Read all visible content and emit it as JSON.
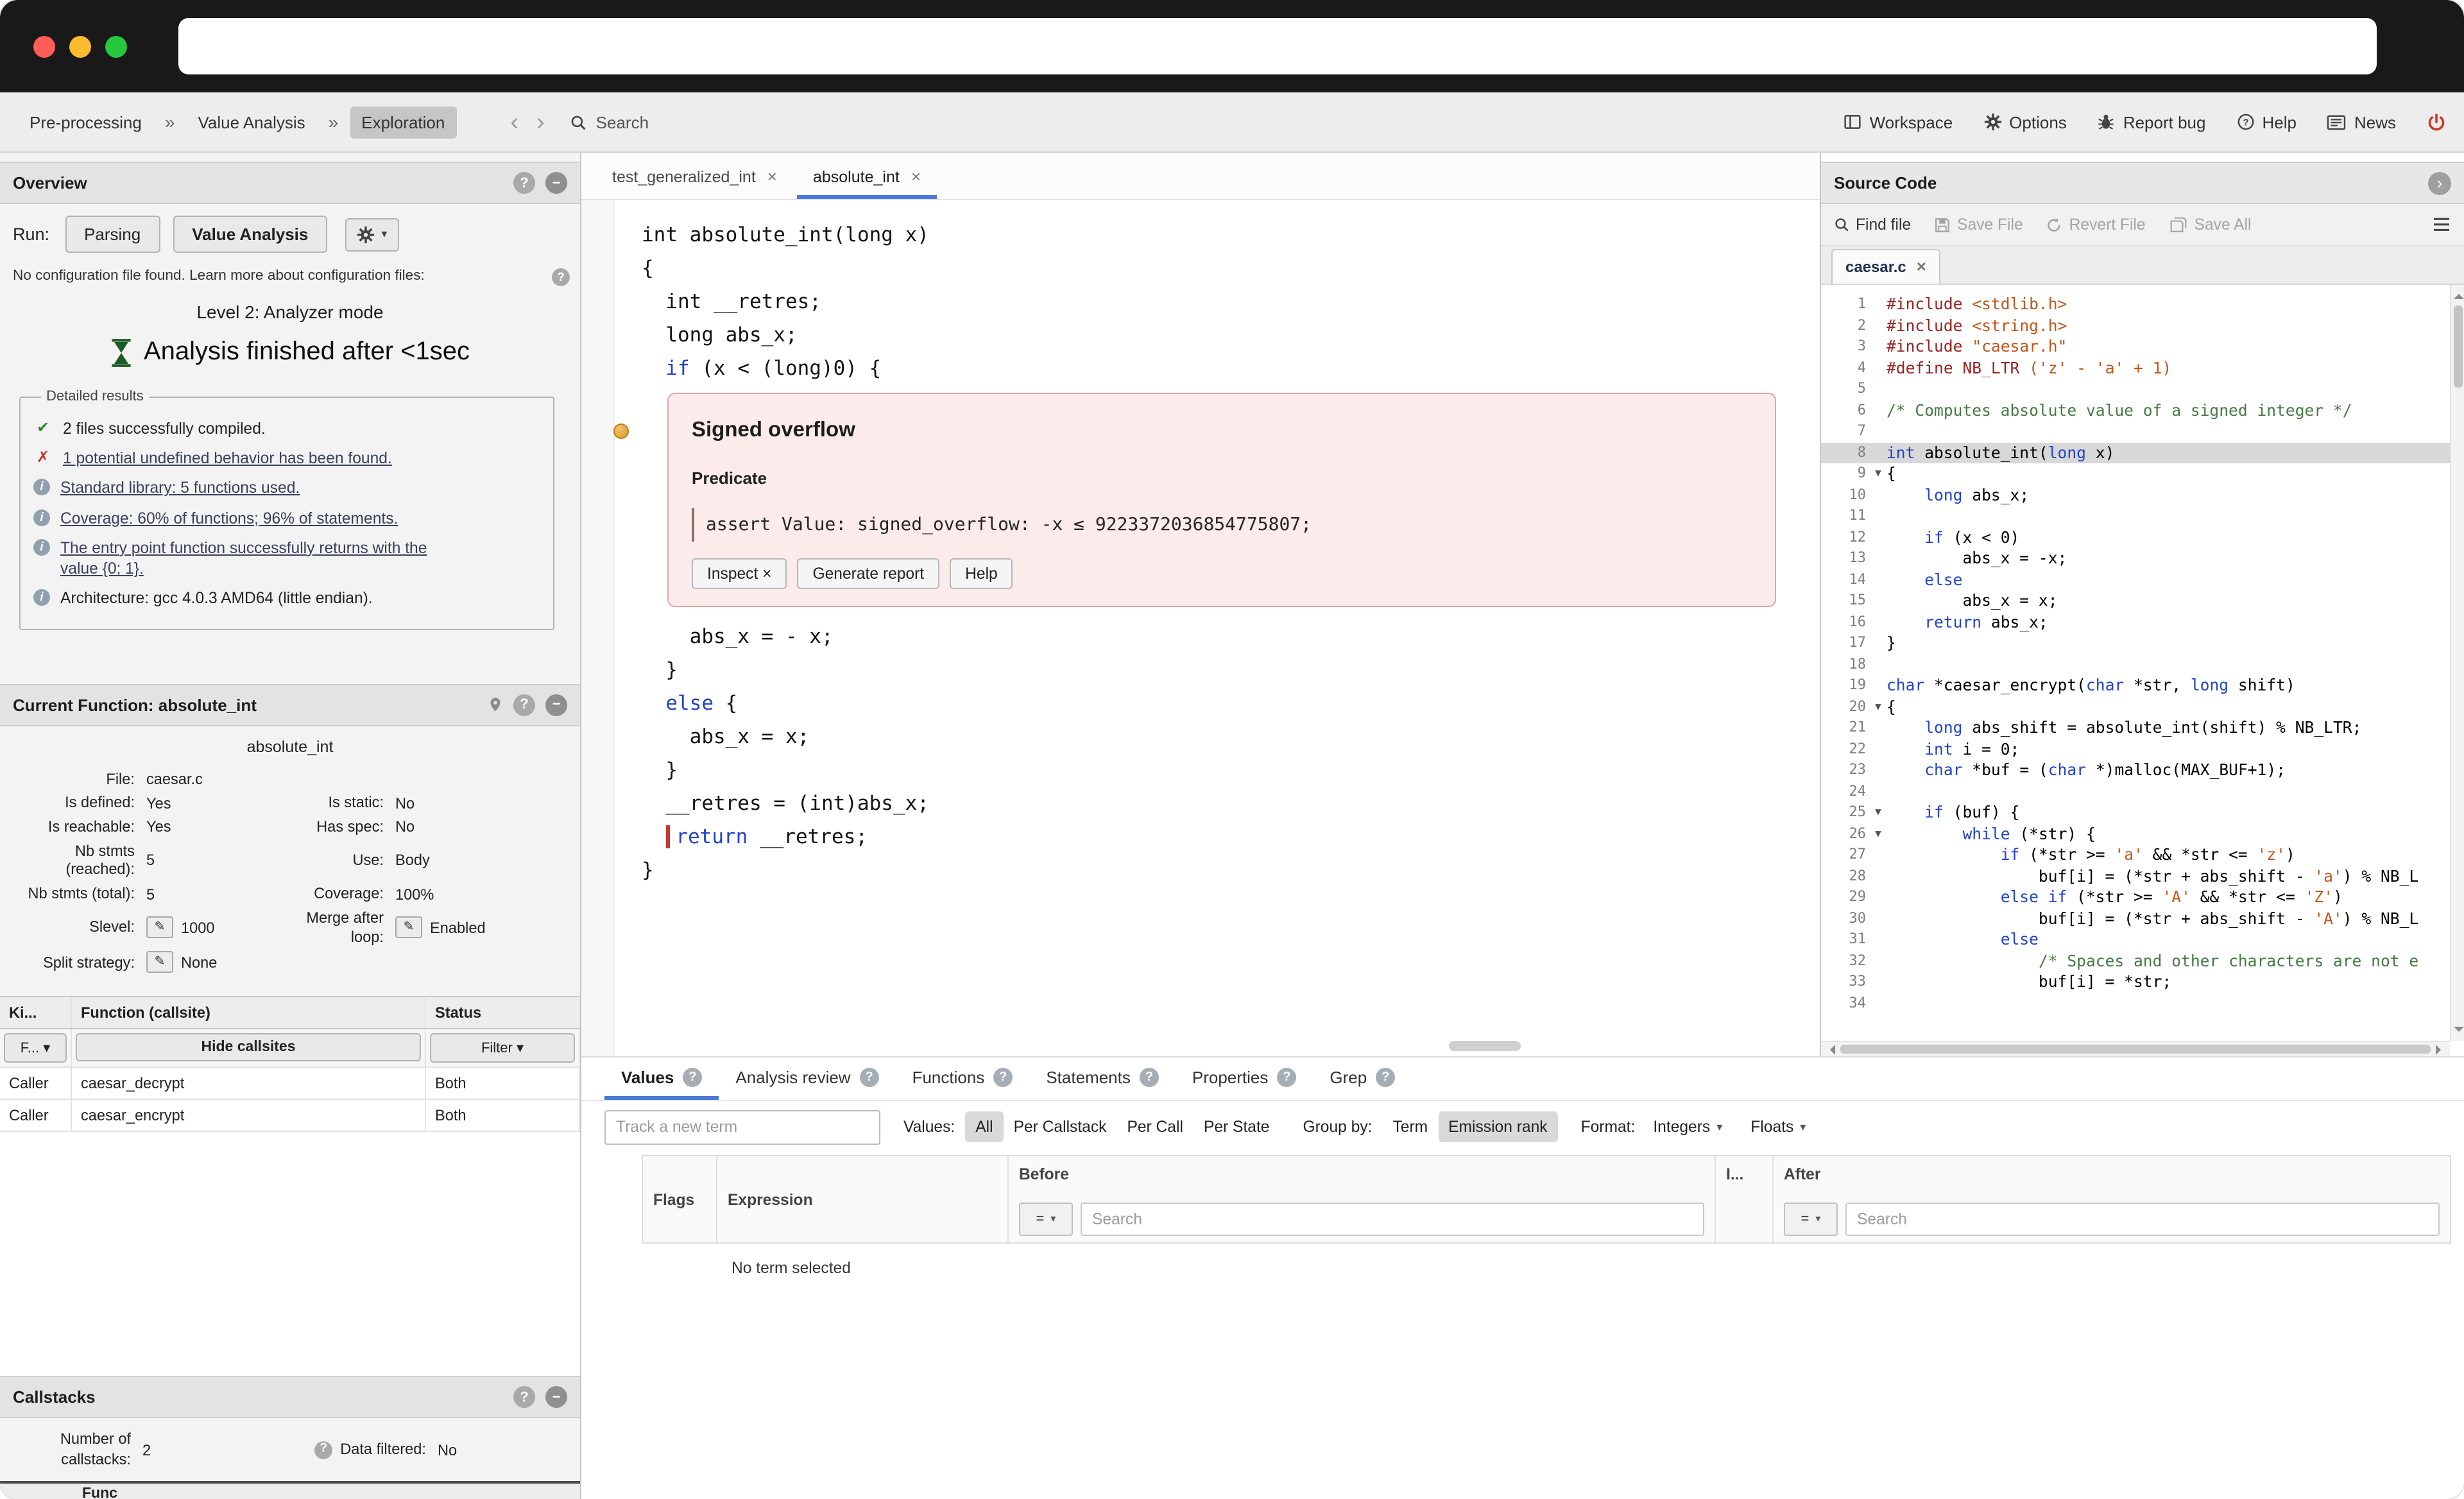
{
  "colors": {
    "accent": "#4a79d9",
    "alert_bg": "#fcebeb",
    "alert_border": "#e0a4a4",
    "marker_amber": "#dd9a26",
    "power_red": "#cf3428"
  },
  "toolbar": {
    "breadcrumb": [
      {
        "label": "Pre-processing",
        "active": false
      },
      {
        "label": "Value Analysis",
        "active": false
      },
      {
        "label": "Exploration",
        "active": true
      }
    ],
    "nav_back": "‹",
    "nav_forward": "›",
    "search_label": "Search",
    "actions": [
      {
        "label": "Workspace",
        "icon": "workspace"
      },
      {
        "label": "Options",
        "icon": "options"
      },
      {
        "label": "Report bug",
        "icon": "report-bug"
      },
      {
        "label": "Help",
        "icon": "help"
      },
      {
        "label": "News",
        "icon": "news"
      }
    ]
  },
  "sidebar": {
    "overview": {
      "title": "Overview",
      "run_label": "Run:",
      "buttons": [
        "Parsing",
        "Value Analysis"
      ],
      "config_note": "No configuration file found. Learn more about configuration files:",
      "level": "Level 2: Analyzer mode",
      "finished": "Analysis finished after <1sec",
      "results_legend": "Detailed results",
      "results": [
        {
          "icon": "check",
          "text": "2 files successfully compiled.",
          "link": false
        },
        {
          "icon": "cross",
          "text": "1 potential undefined behavior has been found.",
          "link": true
        },
        {
          "icon": "info",
          "text": "Standard library: 5 functions used.",
          "link": true
        },
        {
          "icon": "info",
          "text": "Coverage: 60% of functions; 96% of statements.",
          "link": true
        },
        {
          "icon": "info",
          "text": "The entry point function successfully returns with the value {0; 1}.",
          "link": true
        },
        {
          "icon": "info",
          "text": "Architecture: gcc 4.0.3 AMD64 (little endian).",
          "link": false
        }
      ]
    },
    "current_function": {
      "title": "Current Function: absolute_int",
      "name": "absolute_int",
      "rows": [
        [
          {
            "l": "File:",
            "v": "caesar.c"
          }
        ],
        [
          {
            "l": "Is defined:",
            "v": "Yes"
          },
          {
            "l": "Is static:",
            "v": "No"
          }
        ],
        [
          {
            "l": "Is reachable:",
            "v": "Yes"
          },
          {
            "l": "Has spec:",
            "v": "No"
          }
        ],
        [
          {
            "l": "Nb stmts (reached):",
            "v": "5"
          },
          {
            "l": "Use:",
            "v": "Body"
          }
        ],
        [
          {
            "l": "Nb stmts (total):",
            "v": "5"
          },
          {
            "l": "Coverage:",
            "v": "100%"
          }
        ],
        [
          {
            "l": "Slevel:",
            "v": "1000",
            "edit": true
          },
          {
            "l": "Merge after loop:",
            "v": "Enabled",
            "edit": true
          }
        ],
        [
          {
            "l": "Split strategy:",
            "v": "None",
            "edit": true
          }
        ]
      ]
    },
    "callers": {
      "headers": [
        "Ki...",
        "Function (callsite)",
        "Status"
      ],
      "filter_kind": "F...",
      "filter_hide": "Hide callsites",
      "filter_status": "Filter",
      "rows": [
        [
          "Caller",
          "caesar_decrypt",
          "Both"
        ],
        [
          "Caller",
          "caesar_encrypt",
          "Both"
        ]
      ]
    },
    "callstacks": {
      "title": "Callstacks",
      "count_label": "Number of callstacks:",
      "count_value": "2",
      "filtered_label": "Data filtered:",
      "filtered_value": "No",
      "cut_label": "Func"
    }
  },
  "ast": {
    "tabs": [
      {
        "label": "test_generalized_int",
        "active": false
      },
      {
        "label": "absolute_int",
        "active": true
      }
    ],
    "lines": [
      {
        "toks": [
          [
            "p",
            "int absolute_int(long x)"
          ]
        ]
      },
      {
        "toks": [
          [
            "p",
            "{"
          ]
        ]
      },
      {
        "toks": [
          [
            "p",
            "  int __retres;"
          ]
        ]
      },
      {
        "toks": [
          [
            "p",
            "  long abs_x;"
          ]
        ]
      },
      {
        "toks": [
          [
            "p",
            "  "
          ],
          [
            "k",
            "if"
          ],
          [
            "p",
            " (x < (long)0) {"
          ]
        ]
      },
      {
        "alert": true
      },
      {
        "toks": [
          [
            "p",
            "    abs_x = - x;"
          ]
        ]
      },
      {
        "toks": [
          [
            "p",
            "  }"
          ]
        ]
      },
      {
        "toks": [
          [
            "p",
            "  "
          ],
          [
            "k",
            "else"
          ],
          [
            "p",
            " {"
          ]
        ]
      },
      {
        "toks": [
          [
            "p",
            "    abs_x = x;"
          ]
        ]
      },
      {
        "toks": [
          [
            "p",
            "  }"
          ]
        ]
      },
      {
        "toks": [
          [
            "p",
            "  __retres = (int)abs_x;"
          ]
        ]
      },
      {
        "ind": "  ",
        "bar": true,
        "toks": [
          [
            "k",
            "return"
          ],
          [
            "p",
            " __retres;"
          ]
        ]
      },
      {
        "toks": [
          [
            "p",
            "}"
          ]
        ]
      }
    ],
    "alert": {
      "title": "Signed overflow",
      "subtitle": "Predicate",
      "assert_text": "assert Value: signed_overflow: -x ≤ 9223372036854775807;",
      "buttons": [
        "Inspect ×",
        "Generate report",
        "Help"
      ]
    }
  },
  "source": {
    "title": "Source Code",
    "toolbar": [
      {
        "label": "Find file",
        "icon": "find",
        "enabled": true
      },
      {
        "label": "Save File",
        "icon": "save",
        "enabled": false
      },
      {
        "label": "Revert File",
        "icon": "revert",
        "enabled": false
      },
      {
        "label": "Save All",
        "icon": "save-all",
        "enabled": false
      }
    ],
    "tab": "caesar.c",
    "lines": [
      {
        "n": 1,
        "toks": [
          [
            "d",
            "#include "
          ],
          [
            "s",
            "<stdlib.h>"
          ]
        ]
      },
      {
        "n": 2,
        "toks": [
          [
            "d",
            "#include "
          ],
          [
            "s",
            "<string.h>"
          ]
        ]
      },
      {
        "n": 3,
        "toks": [
          [
            "d",
            "#include "
          ],
          [
            "s",
            "\"caesar.h\""
          ]
        ]
      },
      {
        "n": 4,
        "toks": [
          [
            "d",
            "#define NB_LTR "
          ],
          [
            "s",
            "('z' - 'a' + 1)"
          ]
        ]
      },
      {
        "n": 5,
        "toks": []
      },
      {
        "n": 6,
        "toks": [
          [
            "c",
            "/* Computes absolute value of a signed integer */"
          ]
        ]
      },
      {
        "n": 7,
        "toks": []
      },
      {
        "n": 8,
        "hl": true,
        "toks": [
          [
            "k",
            "int"
          ],
          [
            "p",
            " absolute_int("
          ],
          [
            "k",
            "long"
          ],
          [
            "p",
            " x)"
          ]
        ]
      },
      {
        "n": 9,
        "fold": true,
        "toks": [
          [
            "p",
            "{"
          ]
        ]
      },
      {
        "n": 10,
        "toks": [
          [
            "p",
            "    "
          ],
          [
            "k",
            "long"
          ],
          [
            "p",
            " abs_x;"
          ]
        ]
      },
      {
        "n": 11,
        "toks": []
      },
      {
        "n": 12,
        "toks": [
          [
            "p",
            "    "
          ],
          [
            "k",
            "if"
          ],
          [
            "p",
            " (x < 0)"
          ]
        ]
      },
      {
        "n": 13,
        "toks": [
          [
            "p",
            "        abs_x = -x;"
          ]
        ]
      },
      {
        "n": 14,
        "toks": [
          [
            "p",
            "    "
          ],
          [
            "k",
            "else"
          ]
        ]
      },
      {
        "n": 15,
        "toks": [
          [
            "p",
            "        abs_x = x;"
          ]
        ]
      },
      {
        "n": 16,
        "toks": [
          [
            "p",
            "    "
          ],
          [
            "k",
            "return"
          ],
          [
            "p",
            " abs_x;"
          ]
        ]
      },
      {
        "n": 17,
        "toks": [
          [
            "p",
            "}"
          ]
        ]
      },
      {
        "n": 18,
        "toks": []
      },
      {
        "n": 19,
        "toks": [
          [
            "k",
            "char"
          ],
          [
            "p",
            " *caesar_encrypt("
          ],
          [
            "k",
            "char"
          ],
          [
            "p",
            " *str, "
          ],
          [
            "k",
            "long"
          ],
          [
            "p",
            " shift)"
          ]
        ]
      },
      {
        "n": 20,
        "fold": true,
        "toks": [
          [
            "p",
            "{"
          ]
        ]
      },
      {
        "n": 21,
        "toks": [
          [
            "p",
            "    "
          ],
          [
            "k",
            "long"
          ],
          [
            "p",
            " abs_shift = absolute_int(shift) % NB_LTR;"
          ]
        ]
      },
      {
        "n": 22,
        "toks": [
          [
            "p",
            "    "
          ],
          [
            "k",
            "int"
          ],
          [
            "p",
            " i = 0;"
          ]
        ]
      },
      {
        "n": 23,
        "toks": [
          [
            "p",
            "    "
          ],
          [
            "k",
            "char"
          ],
          [
            "p",
            " *buf = ("
          ],
          [
            "k",
            "char"
          ],
          [
            "p",
            " *)malloc(MAX_BUF+1);"
          ]
        ]
      },
      {
        "n": 24,
        "toks": []
      },
      {
        "n": 25,
        "fold": true,
        "toks": [
          [
            "p",
            "    "
          ],
          [
            "k",
            "if"
          ],
          [
            "p",
            " (buf) {"
          ]
        ]
      },
      {
        "n": 26,
        "fold": true,
        "toks": [
          [
            "p",
            "        "
          ],
          [
            "k",
            "while"
          ],
          [
            "p",
            " (*str) {"
          ]
        ]
      },
      {
        "n": 27,
        "toks": [
          [
            "p",
            "            "
          ],
          [
            "k",
            "if"
          ],
          [
            "p",
            " (*str >= "
          ],
          [
            "s",
            "'a'"
          ],
          [
            "p",
            " && *str <= "
          ],
          [
            "s",
            "'z'"
          ],
          [
            "p",
            ")"
          ]
        ]
      },
      {
        "n": 28,
        "toks": [
          [
            "p",
            "                buf[i] = (*str + abs_shift - "
          ],
          [
            "s",
            "'a'"
          ],
          [
            "p",
            ") % NB_L"
          ]
        ]
      },
      {
        "n": 29,
        "toks": [
          [
            "p",
            "            "
          ],
          [
            "k",
            "else"
          ],
          [
            "p",
            " "
          ],
          [
            "k",
            "if"
          ],
          [
            "p",
            " (*str >= "
          ],
          [
            "s",
            "'A'"
          ],
          [
            "p",
            " && *str <= "
          ],
          [
            "s",
            "'Z'"
          ],
          [
            "p",
            ")"
          ]
        ]
      },
      {
        "n": 30,
        "toks": [
          [
            "p",
            "                buf[i] = (*str + abs_shift - "
          ],
          [
            "s",
            "'A'"
          ],
          [
            "p",
            ") % NB_L"
          ]
        ]
      },
      {
        "n": 31,
        "toks": [
          [
            "p",
            "            "
          ],
          [
            "k",
            "else"
          ]
        ]
      },
      {
        "n": 32,
        "toks": [
          [
            "p",
            "                "
          ],
          [
            "c",
            "/* Spaces and other characters are not e"
          ]
        ]
      },
      {
        "n": 33,
        "toks": [
          [
            "p",
            "                buf[i] = *str;"
          ]
        ]
      },
      {
        "n": 34,
        "toks": []
      }
    ]
  },
  "bottom": {
    "tabs": [
      {
        "label": "Values",
        "active": true
      },
      {
        "label": "Analysis review",
        "active": false
      },
      {
        "label": "Functions",
        "active": false
      },
      {
        "label": "Statements",
        "active": false
      },
      {
        "label": "Properties",
        "active": false
      },
      {
        "label": "Grep",
        "active": false
      }
    ],
    "track_placeholder": "Track a new term",
    "values_label": "Values:",
    "values_options": [
      {
        "label": "All",
        "selected": true
      },
      {
        "label": "Per Callstack",
        "selected": false
      },
      {
        "label": "Per Call",
        "selected": false
      },
      {
        "label": "Per State",
        "selected": false
      }
    ],
    "groupby_label": "Group by:",
    "groupby_options": [
      {
        "label": "Term",
        "selected": false
      },
      {
        "label": "Emission rank",
        "selected": true
      }
    ],
    "format_label": "Format:",
    "format_options": [
      "Integers",
      "Floats"
    ],
    "columns": [
      "Flags",
      "Expression",
      "Before",
      "I...",
      "After"
    ],
    "filter_eq": "=",
    "search_placeholder": "Search",
    "empty_message": "No term selected"
  }
}
